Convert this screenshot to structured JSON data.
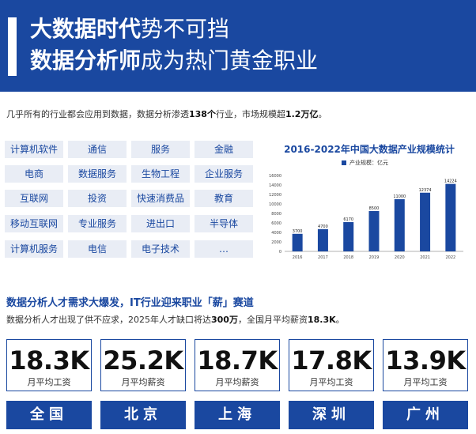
{
  "header": {
    "line1_bold": "大数据时代",
    "line1_rest": "势不可挡",
    "line2_bold": "数据分析师",
    "line2_rest": "成为热门黄金职业"
  },
  "intro": {
    "p1": "几乎所有的行业都会应用到数据，数据分析渗透",
    "b1": "138个",
    "p2": "行业，市场规模超",
    "b2": "1.2万亿",
    "p3": "。"
  },
  "tags": [
    [
      "计算机软件",
      "通信",
      "服务",
      "金融"
    ],
    [
      "电商",
      "数据服务",
      "生物工程",
      "企业服务"
    ],
    [
      "互联网",
      "投资",
      "快速消费品",
      "教育"
    ],
    [
      "移动互联网",
      "专业服务",
      "进出口",
      "半导体"
    ],
    [
      "计算机服务",
      "电信",
      "电子技术",
      "…"
    ]
  ],
  "chart_data": {
    "type": "bar",
    "title": "2016-2022年中国大数据产业规模统计",
    "legend_label": "产业规模：亿元",
    "categories": [
      "2016",
      "2017",
      "2018",
      "2019",
      "2020",
      "2021",
      "2022"
    ],
    "values": [
      3700,
      4700,
      6170,
      8500,
      11000,
      12374,
      14224
    ],
    "value_labels": [
      "3700",
      "4700",
      "6170",
      "8500",
      "11000",
      "12374",
      "14224"
    ],
    "y_ticks": [
      "0",
      "2000",
      "4000",
      "6000",
      "8000",
      "10000",
      "12000",
      "14000",
      "16000"
    ],
    "ylim": [
      0,
      16000
    ],
    "bar_color": "#1a48a0"
  },
  "section": {
    "title": "数据分析人才需求大爆发，IT行业迎来职业「薪」赛道",
    "p1": "数据分析人才出现了供不应求，2025年人才缺口将达",
    "b1": "300万",
    "p2": "，全国月平均薪资",
    "b2": "18.3K",
    "p3": "。"
  },
  "cards": [
    {
      "value": "18.3K",
      "label": "月平均工资",
      "city": "全国"
    },
    {
      "value": "25.2K",
      "label": "月平均薪资",
      "city": "北京"
    },
    {
      "value": "18.7K",
      "label": "月平均薪资",
      "city": "上海"
    },
    {
      "value": "17.8K",
      "label": "月平均工资",
      "city": "深圳"
    },
    {
      "value": "13.9K",
      "label": "月平均工资",
      "city": "广州"
    }
  ]
}
